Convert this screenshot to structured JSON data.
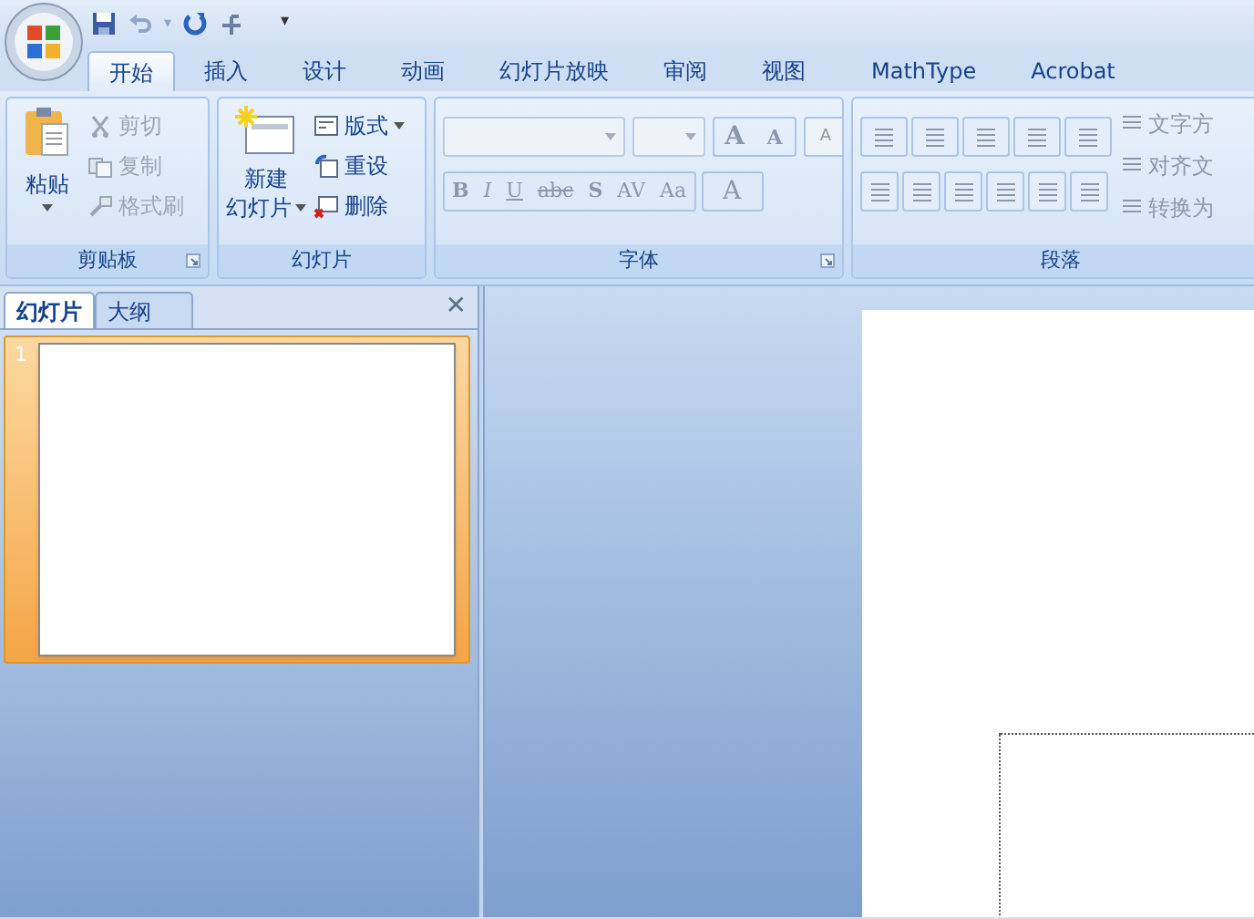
{
  "quick_access": {
    "undo_caret": "▾",
    "customize": "▾"
  },
  "tabs": [
    {
      "label": "开始",
      "selected": true
    },
    {
      "label": "插入",
      "selected": false
    },
    {
      "label": "设计",
      "selected": false
    },
    {
      "label": "动画",
      "selected": false
    },
    {
      "label": "幻灯片放映",
      "selected": false
    },
    {
      "label": "审阅",
      "selected": false
    },
    {
      "label": "视图",
      "selected": false
    },
    {
      "label": "MathType",
      "selected": false
    },
    {
      "label": "Acrobat",
      "selected": false
    }
  ],
  "clipboard": {
    "title": "剪贴板",
    "paste": "粘贴",
    "items": [
      {
        "label": "剪切",
        "disabled": true
      },
      {
        "label": "复制",
        "disabled": true
      },
      {
        "label": "格式刷",
        "disabled": true
      }
    ]
  },
  "slides_group": {
    "title": "幻灯片",
    "new_slide": [
      "新建",
      "幻灯片"
    ],
    "items": [
      {
        "label": "版式",
        "dropdown": true
      },
      {
        "label": "重设",
        "dropdown": false
      },
      {
        "label": "删除",
        "dropdown": false
      }
    ]
  },
  "font": {
    "title": "字体",
    "grow": "A",
    "shrink": "A",
    "clear": "A",
    "format_buttons": [
      "B",
      "I",
      "U",
      "abc",
      "S",
      "AV",
      "Aa"
    ],
    "color_button": "A",
    "disabled": true
  },
  "paragraph": {
    "title": "段落",
    "side_items": [
      "文字方",
      "对齐文",
      "转换为"
    ],
    "disabled": true
  },
  "pane": {
    "tabs": [
      {
        "label": "幻灯片",
        "selected": true
      },
      {
        "label": "大纲",
        "selected": false
      }
    ],
    "close": "✕",
    "thumbnails": [
      {
        "number": "1",
        "selected": true
      }
    ]
  }
}
